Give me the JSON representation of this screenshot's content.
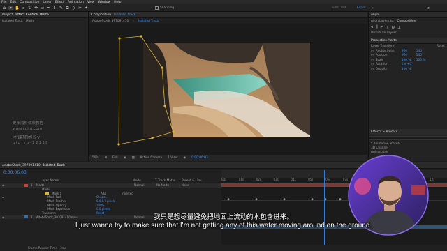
{
  "menu": [
    "File",
    "Edit",
    "Composition",
    "Layer",
    "Effect",
    "Animation",
    "View",
    "Window",
    "Help"
  ],
  "toolbar": {
    "snapping": "Snapping",
    "workspace_dim": "Tedits Out",
    "workspace_active": "Editor"
  },
  "project_panel": {
    "tabs": [
      "Project",
      "Effect Controls Matte"
    ],
    "layer_title": "Isolated Track - Matte",
    "watermark_lines": [
      "更多海外优质教程",
      "www.cgltg.com",
      "团课加团长v",
      "q i q i y u - 1 2 1 3 8"
    ]
  },
  "composition_panel": {
    "tab_label": "Composition",
    "tab_comp": "Isolated Track",
    "breadcrumb": [
      "AdobeStock_397091410",
      "Isolated Track"
    ],
    "footer": {
      "zoom": "50%",
      "resolution": "Full",
      "camera": "Active Camera",
      "views": "1 View",
      "timecode": "0:00:06:03"
    }
  },
  "align_panel": {
    "title": "Align",
    "align_to_label": "Align Layers to:",
    "align_to_value": "Composition",
    "distribute_label": "Distribute Layers"
  },
  "properties_panel": {
    "title": "Properties Matte",
    "section": "Layer Transform",
    "reset": "Reset",
    "props": [
      {
        "name": "Anchor Point",
        "v1": "960",
        "v2": "540"
      },
      {
        "name": "Position",
        "v1": "960",
        "v2": "540"
      },
      {
        "name": "Scale",
        "v1": "100 %",
        "v2": "100 %"
      },
      {
        "name": "Rotation",
        "v1": "0 x +0°",
        "v2": ""
      },
      {
        "name": "Opacity",
        "v1": "100 %",
        "v2": ""
      }
    ]
  },
  "effects_panel": {
    "title": "Effects & Presets",
    "items": [
      "* Animation Presets",
      "3D Channel",
      "Animatable"
    ]
  },
  "timeline": {
    "tabs": [
      "AdobeStock_397091410",
      "Isolated Track"
    ],
    "timecode": "0:00:06:03",
    "columns": [
      "Layer Name",
      "Mode",
      "T  Track Matte",
      "Parent & Link"
    ],
    "layers": [
      {
        "num": "1",
        "name": "Matte",
        "mode": "Normal",
        "matte": "No Matte",
        "parent": "None"
      },
      {
        "num": "",
        "name": "Masks",
        "mode": "",
        "matte": "",
        "parent": ""
      },
      {
        "num": "",
        "name": "Mask 1",
        "mode": "Add",
        "matte": "Inverted",
        "parent": ""
      },
      {
        "num": "",
        "name": "Mask Path",
        "mode": "Shape...",
        "matte": "",
        "parent": ""
      },
      {
        "num": "",
        "name": "Mask Feather",
        "mode": "0.0,0.0 pixels",
        "matte": "",
        "parent": ""
      },
      {
        "num": "",
        "name": "Mask Opacity",
        "mode": "100%",
        "matte": "",
        "parent": ""
      },
      {
        "num": "",
        "name": "Mask Expansion",
        "mode": "0.0 pixels",
        "matte": "",
        "parent": ""
      },
      {
        "num": "",
        "name": "Transform",
        "mode": "Reset",
        "matte": "",
        "parent": ""
      },
      {
        "num": "2",
        "name": "AdobeStock_397091410.mov",
        "mode": "Normal",
        "matte": "",
        "parent": "None"
      }
    ],
    "ruler": [
      "00s",
      "01s",
      "02s",
      "03s",
      "04s",
      "05s",
      "06s",
      "07s",
      "08s",
      "09s",
      "10s",
      "11s",
      "12s"
    ],
    "footer_label": "Frame Render Time",
    "footer_value": "3ms"
  },
  "captions": {
    "chinese": "我只是想尽量避免把地面上流动的水包含进来。",
    "english": "I just wanna try to make sure that I'm not getting any of this water moving around on the ground."
  },
  "colors": {
    "accent": "#3f8df2",
    "label_red": "#c0463a",
    "mask_yellow": "#d9b53a",
    "playhead": "#2f7de1"
  }
}
